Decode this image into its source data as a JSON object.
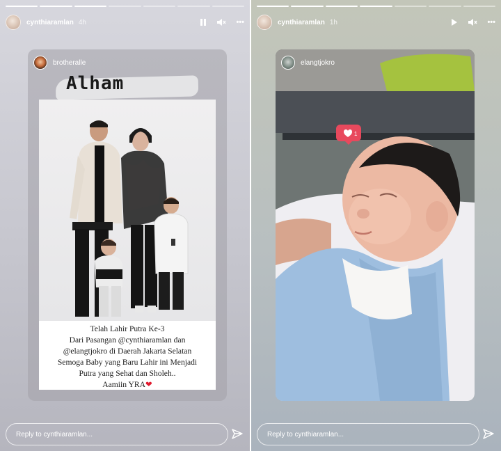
{
  "left_story": {
    "username": "cynthiaramlan",
    "age": "4h",
    "post_username": "brotheralle",
    "header_text": "Alham",
    "caption_lines": [
      "Telah Lahir Putra Ke-3",
      "Dari Pasangan @cynthiaramlan dan",
      "@elangtjokro di Daerah Jakarta Selatan",
      "Semoga Baby yang Baru Lahir ini Menjadi",
      "Putra yang Sehat dan Sholeh..",
      "Aamiin YRA"
    ],
    "reply_placeholder": "Reply to cynthiaramlan...",
    "more_label": "•••"
  },
  "right_story": {
    "username": "cynthiaramlan",
    "age": "1h",
    "post_username": "elangtjokro",
    "like_count": "1",
    "reply_placeholder": "Reply to cynthiaramlan...",
    "more_label": "•••"
  },
  "colors": {
    "heart": "#e01b2f",
    "like_badge": "#e8495d",
    "blanket": "#9ebedf"
  }
}
